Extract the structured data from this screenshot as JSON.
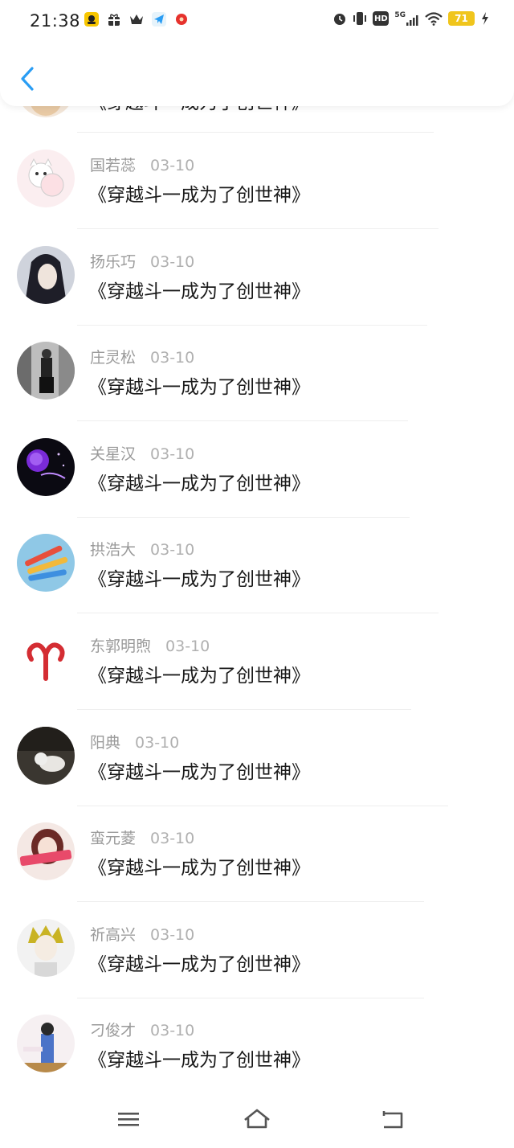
{
  "status_bar": {
    "time": "21:38",
    "battery": "71",
    "network": "5G",
    "hd_label": "HD",
    "notification_icons": [
      "qq-icon",
      "gift-icon",
      "crown-icon",
      "telegram-icon",
      "weibo-icon"
    ],
    "system_icons": [
      "alarm-icon",
      "vibrate-icon",
      "hd-icon",
      "signal-5g-icon",
      "wifi-icon",
      "battery-icon",
      "charging-icon"
    ]
  },
  "header": {
    "back_icon": "chevron-left-icon",
    "accent_color": "#2a9df4"
  },
  "list": {
    "partial_top": {
      "message": "《穿越斗一成为了创世神》"
    },
    "items": [
      {
        "name": "国若蕊",
        "date": "03-10",
        "message": "《穿越斗一成为了创世神》",
        "avatar": "cartoon-cats"
      },
      {
        "name": "扬乐巧",
        "date": "03-10",
        "message": "《穿越斗一成为了创世神》",
        "avatar": "anime-portrait"
      },
      {
        "name": "庄灵松",
        "date": "03-10",
        "message": "《穿越斗一成为了创世神》",
        "avatar": "street-photo"
      },
      {
        "name": "关星汉",
        "date": "03-10",
        "message": "《穿越斗一成为了创世神》",
        "avatar": "purple-rose"
      },
      {
        "name": "拱浩大",
        "date": "03-10",
        "message": "《穿越斗一成为了创世神》",
        "avatar": "colored-pens"
      },
      {
        "name": "东郭明煦",
        "date": "03-10",
        "message": "《穿越斗一成为了创世神》",
        "avatar": "aries-symbol"
      },
      {
        "name": "阳典",
        "date": "03-10",
        "message": "《穿越斗一成为了创世神》",
        "avatar": "cat-photo"
      },
      {
        "name": "蛮元菱",
        "date": "03-10",
        "message": "《穿越斗一成为了创世神》",
        "avatar": "doll-with-banner"
      },
      {
        "name": "祈高兴",
        "date": "03-10",
        "message": "《穿越斗一成为了创世神》",
        "avatar": "anime-boy"
      },
      {
        "name": "刁俊才",
        "date": "03-10",
        "message": "《穿越斗一成为了创世神》",
        "avatar": "person-photo"
      }
    ]
  },
  "nav_bar": {
    "buttons": [
      "menu-icon",
      "home-icon",
      "back-icon"
    ]
  }
}
